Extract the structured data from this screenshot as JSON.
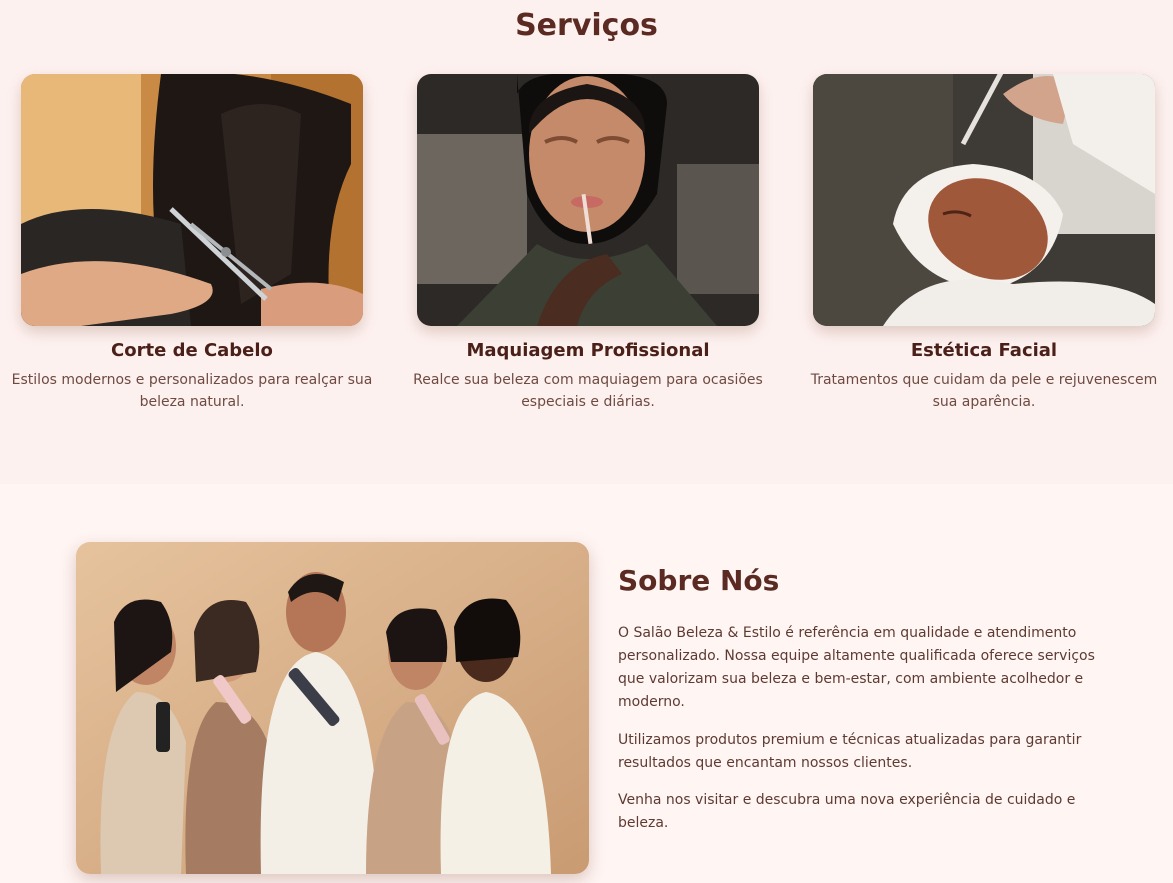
{
  "services": {
    "title": "Serviços",
    "items": [
      {
        "title": "Corte de Cabelo",
        "description": "Estilos modernos e personalizados para realçar sua beleza natural.",
        "image": "haircut-photo"
      },
      {
        "title": "Maquiagem Profissional",
        "description": "Realce sua beleza com maquiagem para ocasiões especiais e diárias.",
        "image": "makeup-photo"
      },
      {
        "title": "Estética Facial",
        "description": "Tratamentos que cuidam da pele e rejuvenescem sua aparência.",
        "image": "facial-treatment-photo"
      }
    ]
  },
  "about": {
    "title": "Sobre Nós",
    "image": "team-photo",
    "paragraphs": [
      "O Salão Beleza & Estilo é referência em qualidade e atendimento personalizado. Nossa equipe altamente qualificada oferece serviços que valorizam sua beleza e bem-estar, com ambiente acolhedor e moderno.",
      "Utilizamos produtos premium e técnicas atualizadas para garantir resultados que encantam nossos clientes.",
      "Venha nos visitar e descubra uma nova experiência de cuidado e beleza."
    ]
  },
  "colors": {
    "background": "#fdf1ef",
    "heading": "#5b2a22",
    "text": "#6e4a42"
  }
}
